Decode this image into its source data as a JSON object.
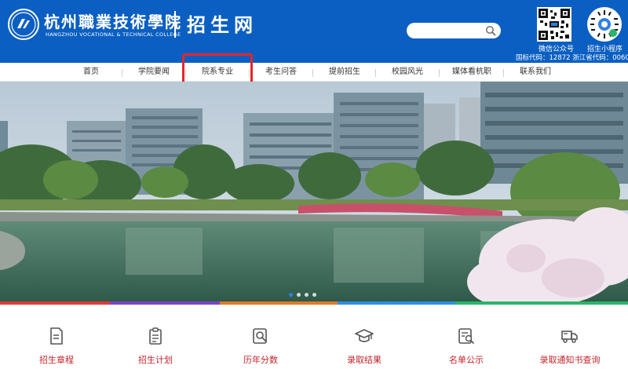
{
  "header": {
    "college_name_cn": "杭州職業技術學院",
    "college_name_en": "HANGZHOU VOCATIONAL & TECHNICAL COLLEGE",
    "site_title": "招生网",
    "search": {
      "placeholder": ""
    },
    "qr_wechat_label": "微信公众号",
    "qr_miniprogram_label": "招生小程序",
    "codes": "国标代码：12872  浙江省代码：0060"
  },
  "nav": {
    "items": [
      {
        "label": "首页"
      },
      {
        "label": "学院要闻"
      },
      {
        "label": "院系专业"
      },
      {
        "label": "考生问答"
      },
      {
        "label": "提前招生"
      },
      {
        "label": "校园风光"
      },
      {
        "label": "媒体看杭职"
      },
      {
        "label": "联系我们"
      }
    ],
    "highlighted": "院系专业"
  },
  "banner": {
    "slides": 4,
    "active_slide": 1
  },
  "colorbar": [
    "#e03a3a",
    "#7a45c2",
    "#e07a2a",
    "#2f8fe0",
    "#2bb56a"
  ],
  "quick_links": [
    {
      "label": "招生章程",
      "icon": "document-icon"
    },
    {
      "label": "招生计划",
      "icon": "clipboard-icon"
    },
    {
      "label": "历年分数",
      "icon": "magnifier-doc-icon"
    },
    {
      "label": "录取结果",
      "icon": "graduation-cap-icon"
    },
    {
      "label": "名单公示",
      "icon": "list-search-icon"
    },
    {
      "label": "录取通知书查询",
      "icon": "truck-icon"
    }
  ],
  "colors": {
    "brand_blue": "#0b5fc2",
    "accent_red": "#c3242a",
    "highlight_red": "#e5252b"
  }
}
